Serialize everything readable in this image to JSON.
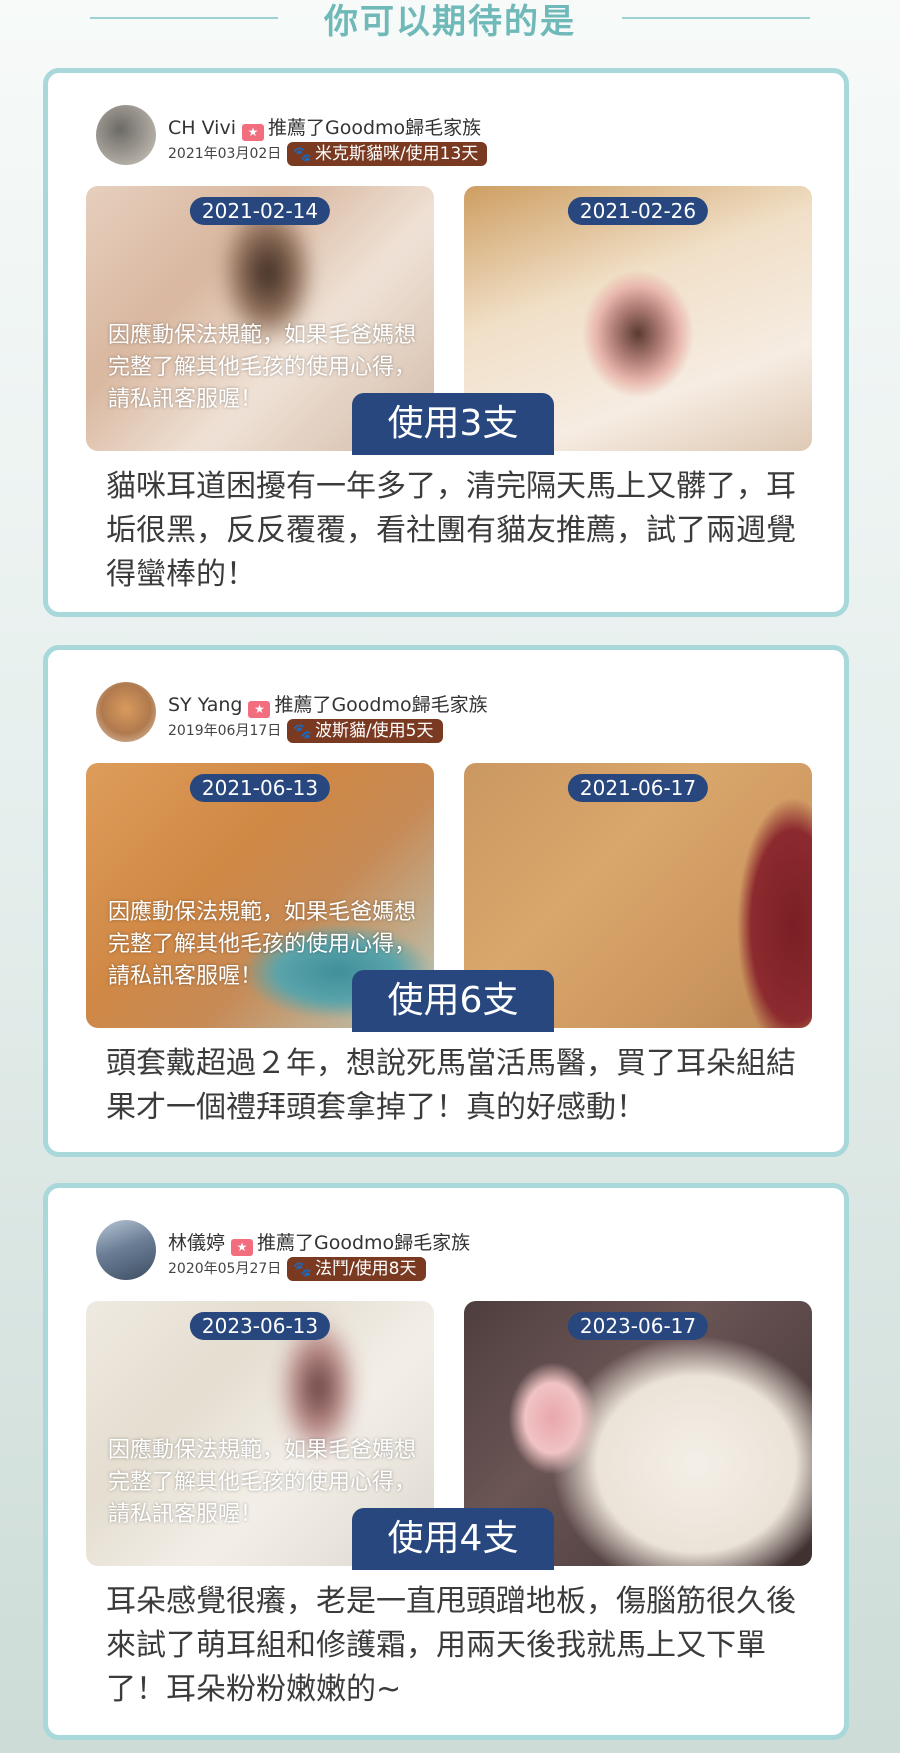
{
  "header": {
    "title": "你可以期待的是"
  },
  "notice_text": "因應動保法規範，如果毛爸媽想完整了解其他毛孩的使用心得，請私訊客服喔！",
  "reviews": [
    {
      "name": "CH  Vivi",
      "recommend": "推薦了Goodmo歸毛家族",
      "date": "2021年03月02日",
      "badge": "米克斯貓咪/使用13天",
      "before_date": "2021-02-14",
      "after_date": "2021-02-26",
      "usage": "使用3支",
      "text": "貓咪耳道困擾有一年多了，清完隔天馬上又髒了，耳垢很黑，反反覆覆，看社團有貓友推薦，試了兩週覺得蠻棒的！"
    },
    {
      "name": "SY Yang",
      "recommend": "推薦了Goodmo歸毛家族",
      "date": "2019年06月17日",
      "badge": "波斯貓/使用5天",
      "before_date": "2021-06-13",
      "after_date": "2021-06-17",
      "usage": "使用6支",
      "text": "頭套戴超過２年，想說死馬當活馬醫，買了耳朵組結果才一個禮拜頭套拿掉了！真的好感動！"
    },
    {
      "name": "林儀婷",
      "recommend": "推薦了Goodmo歸毛家族",
      "date": "2020年05月27日",
      "badge": "法鬥/使用8天",
      "before_date": "2023-06-13",
      "after_date": "2023-06-17",
      "usage": "使用4支",
      "text": "耳朵感覺很癢，老是一直甩頭蹭地板，傷腦筋很久後來試了萌耳組和修護霜，用兩天後我就馬上又下單了！耳朵粉粉嫩嫩的~"
    }
  ],
  "icons": {
    "star": "star-icon",
    "paw": "paw-icon"
  },
  "colors": {
    "accent": "#6fb9b8",
    "border": "#a9d8db",
    "pill": "#27477e",
    "badge": "#7a3a22"
  }
}
